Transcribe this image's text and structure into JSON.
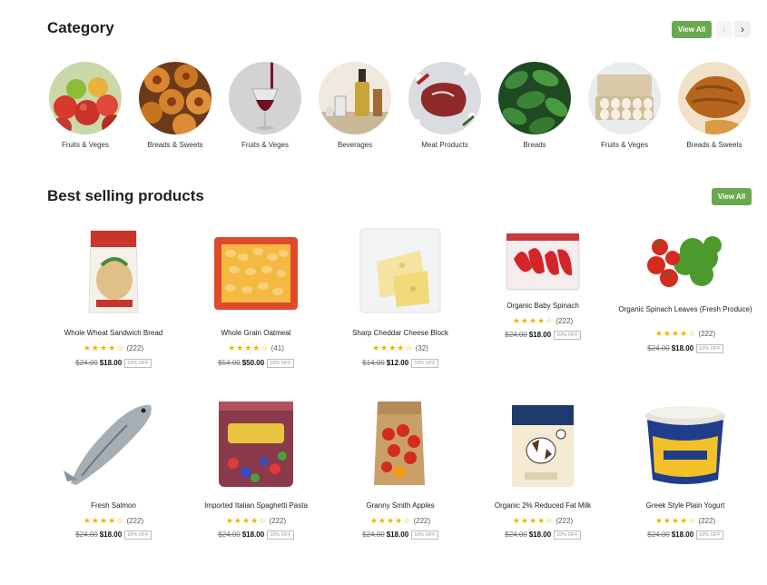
{
  "category": {
    "title": "Category",
    "view_all": "View All",
    "prev_icon": "chevron-left-icon",
    "next_icon": "chevron-right-icon",
    "items": [
      {
        "label": "Fruits & Veges",
        "icon": "apples-image"
      },
      {
        "label": "Breads & Sweets",
        "icon": "pastries-image"
      },
      {
        "label": "Fruits & Veges",
        "icon": "wine-glass-image"
      },
      {
        "label": "Beverages",
        "icon": "bottles-image"
      },
      {
        "label": "Meat Products",
        "icon": "steak-image"
      },
      {
        "label": "Breads",
        "icon": "mint-leaves-image"
      },
      {
        "label": "Fruits & Veges",
        "icon": "eggs-image"
      },
      {
        "label": "Breads & Sweets",
        "icon": "croissant-image"
      }
    ]
  },
  "best_selling": {
    "title": "Best selling products",
    "view_all": "View All",
    "products": [
      {
        "name": "Whole Wheat Sandwich Bread",
        "rating_count": "(222)",
        "old_price": "$24.00",
        "price": "$18.00",
        "discount": "10% OFF",
        "image": "bread-bag-image"
      },
      {
        "name": "Whole Grain Oatmeal",
        "rating_count": "(41)",
        "old_price": "$54.00",
        "price": "$50.00",
        "discount": "10% OFF",
        "image": "pasta-tray-image"
      },
      {
        "name": "Sharp Cheddar Cheese Block",
        "rating_count": "(32)",
        "old_price": "$14.00",
        "price": "$12.00",
        "discount": "10% OFF",
        "image": "cheese-bag-image"
      },
      {
        "name": "Organic Baby Spinach",
        "rating_count": "(222)",
        "old_price": "$24.00",
        "price": "$18.00",
        "discount": "10% OFF",
        "image": "peppers-bag-image"
      },
      {
        "name": "Organic Spinach Leaves (Fresh Produce)",
        "rating_count": "(222)",
        "old_price": "$24.00",
        "price": "$18.00",
        "discount": "10% OFF",
        "image": "broccoli-tomato-image"
      },
      {
        "name": "Fresh Salmon",
        "rating_count": "(222)",
        "old_price": "$24.00",
        "price": "$18.00",
        "discount": "10% OFF",
        "image": "fish-image"
      },
      {
        "name": "Imported Italian Spaghetti Pasta",
        "rating_count": "(222)",
        "old_price": "$24.00",
        "price": "$18.00",
        "discount": "10% OFF",
        "image": "snack-bag-image"
      },
      {
        "name": "Granny Smith Apples",
        "rating_count": "(222)",
        "old_price": "$24.00",
        "price": "$18.00",
        "discount": "10% OFF",
        "image": "apple-bag-image"
      },
      {
        "name": "Organic 2% Reduced Fat Milk",
        "rating_count": "(222)",
        "old_price": "$24.00",
        "price": "$18.00",
        "discount": "10% OFF",
        "image": "milk-carton-image"
      },
      {
        "name": "Greek Style Plain Yogurt",
        "rating_count": "(222)",
        "old_price": "$24.00",
        "price": "$18.00",
        "discount": "10% OFF",
        "image": "yogurt-tub-image"
      }
    ]
  },
  "colors": {
    "accent": "#6aa84f",
    "star": "#f0b400"
  }
}
